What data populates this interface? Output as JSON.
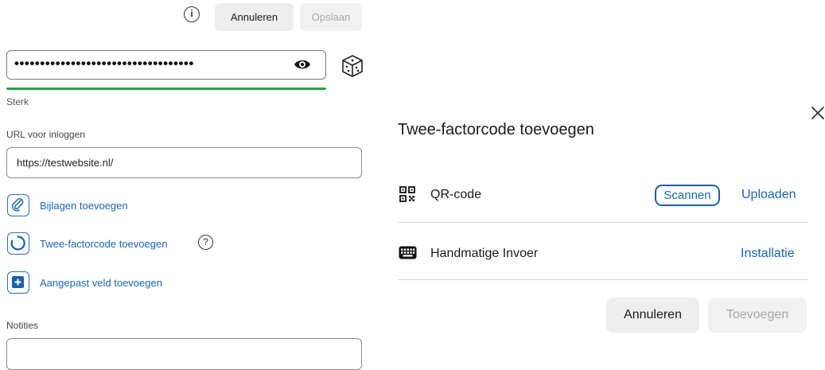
{
  "toolbar": {
    "info_icon": "info-icon",
    "info_glyph": "i",
    "cancel_label": "Annuleren",
    "save_label": "Opslaan"
  },
  "password": {
    "value_masked": "•••••••••••••••••••••••••••••••••••",
    "strength_label": "Sterk",
    "strength_color": "#1fa53a",
    "reveal_icon": "eye-icon",
    "generate_icon": "dice-icon"
  },
  "login_url": {
    "label": "URL voor inloggen",
    "value": "https://testwebsite.nl/"
  },
  "actions": [
    {
      "label": "Bijlagen toevoegen",
      "icon": "paperclip-icon"
    },
    {
      "label": "Twee-factorcode toevoegen",
      "icon": "two-factor-icon"
    },
    {
      "label": "Aangepast veld toevoegen",
      "icon": "plus-square-icon"
    }
  ],
  "help_glyph": "?",
  "notes": {
    "label": "Notities"
  },
  "dialog": {
    "title": "Twee-factorcode toevoegen",
    "close_icon": "close-icon",
    "rows": [
      {
        "label": "QR-code",
        "icon": "qr-code-icon",
        "actions": [
          "Scannen",
          "Uploaden"
        ]
      },
      {
        "label": "Handmatige Invoer",
        "icon": "keyboard-icon",
        "actions": [
          "Installatie"
        ]
      }
    ],
    "cancel_label": "Annuleren",
    "add_label": "Toevoegen"
  },
  "colors": {
    "accent": "#1b63b5",
    "strength": "#1fa53a"
  }
}
